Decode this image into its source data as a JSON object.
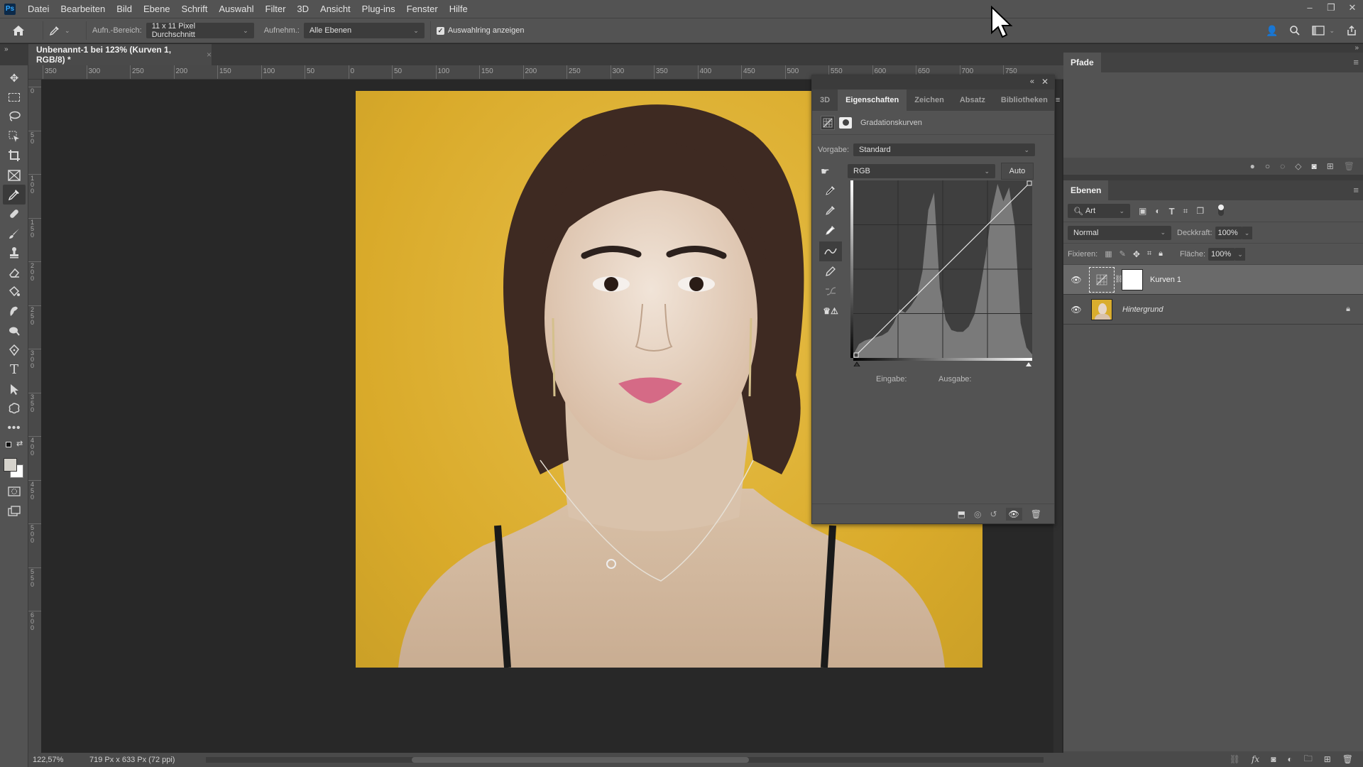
{
  "app": {
    "logo": "Ps"
  },
  "menu": [
    "Datei",
    "Bearbeiten",
    "Bild",
    "Ebene",
    "Schrift",
    "Auswahl",
    "Filter",
    "3D",
    "Ansicht",
    "Plug-ins",
    "Fenster",
    "Hilfe"
  ],
  "window_controls": {
    "minimize": "–",
    "restore": "❐",
    "close": "✕"
  },
  "options_bar": {
    "sample_size_label": "Aufn.-Bereich:",
    "sample_size_value": "11 x 11 Pixel Durchschnitt",
    "sample_label": "Aufnehm.:",
    "sample_value": "Alle Ebenen",
    "show_ring_label": "Auswahlring anzeigen",
    "show_ring_checked": true
  },
  "document": {
    "tab_title": "Unbenannt-1 bei 123% (Kurven 1, RGB/8) *",
    "close": "×"
  },
  "ruler_top": [
    "350",
    "300",
    "250",
    "200",
    "150",
    "100",
    "50",
    "0",
    "50",
    "100",
    "150",
    "200",
    "250",
    "300",
    "350",
    "400",
    "450",
    "500",
    "550",
    "600",
    "650",
    "700",
    "750"
  ],
  "ruler_left": [
    "0",
    "50",
    "100",
    "150",
    "200",
    "250",
    "300",
    "350",
    "400",
    "450",
    "500",
    "550",
    "600"
  ],
  "status": {
    "zoom": "122,57%",
    "doc_info": "719 Px x 633 Px (72 ppi)",
    "arrow": "›"
  },
  "properties": {
    "tabs": [
      "3D",
      "Eigenschaften",
      "Zeichen",
      "Absatz",
      "Bibliotheken"
    ],
    "active_tab": "Eigenschaften",
    "adjustment_title": "Gradationskurven",
    "preset_label": "Vorgabe:",
    "preset_value": "Standard",
    "channel_value": "RGB",
    "auto_label": "Auto",
    "input_label": "Eingabe:",
    "output_label": "Ausgabe:",
    "curve_points": [
      [
        0,
        0
      ],
      [
        255,
        255
      ]
    ],
    "histogram_profile": [
      0.02,
      0.08,
      0.1,
      0.11,
      0.12,
      0.13,
      0.15,
      0.2,
      0.28,
      0.26,
      0.3,
      0.35,
      0.5,
      0.85,
      0.95,
      0.4,
      0.22,
      0.16,
      0.15,
      0.15,
      0.18,
      0.25,
      0.4,
      0.6,
      0.85,
      1.0,
      0.9,
      0.98,
      0.75,
      0.2,
      0.06,
      0.02
    ]
  },
  "paths_panel": {
    "title": "Pfade"
  },
  "layers_panel": {
    "title": "Ebenen",
    "filter_label": "Art",
    "blend_mode": "Normal",
    "opacity_label": "Deckkraft:",
    "opacity_value": "100%",
    "lock_label": "Fixieren:",
    "fill_label": "Fläche:",
    "fill_value": "100%",
    "layers": [
      {
        "name": "Kurven 1",
        "visible": true,
        "selected": true,
        "type": "adjustment"
      },
      {
        "name": "Hintergrund",
        "visible": true,
        "selected": false,
        "type": "pixel",
        "locked": true
      }
    ]
  },
  "colors": {
    "foreground": "#d6d3cc",
    "background": "#ffffff",
    "photo_bg": "#dcae2e"
  }
}
